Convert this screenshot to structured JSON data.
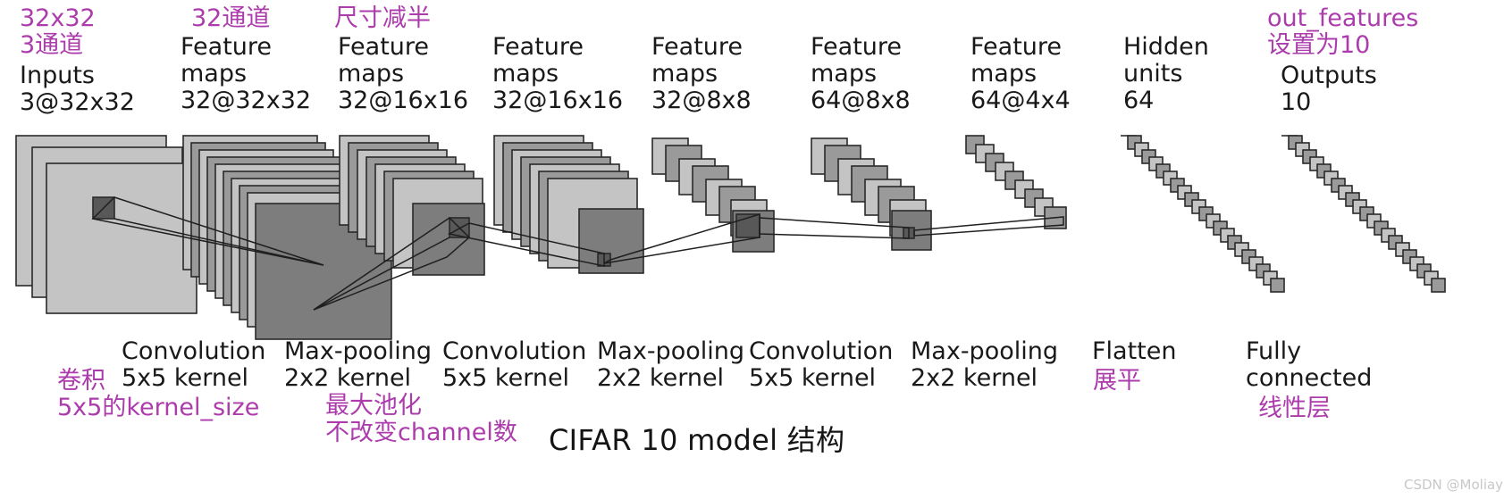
{
  "figure": {
    "title": "CIFAR 10 model 结构",
    "watermark": "CSDN @Moliay",
    "accent_color": "#ac3cac",
    "text_color": "#191919"
  },
  "top_labels": [
    {
      "id": "inputs",
      "annotation": "32x32\n3通道",
      "english": "Inputs\n3@32x32"
    },
    {
      "id": "feature-maps-1",
      "annotation": "32通道",
      "english": "Feature\nmaps\n32@32x32"
    },
    {
      "id": "feature-maps-2",
      "annotation": "尺寸减半",
      "english": "Feature\nmaps\n32@16x16"
    },
    {
      "id": "feature-maps-3",
      "annotation": "",
      "english": "Feature\nmaps\n32@16x16"
    },
    {
      "id": "feature-maps-4",
      "annotation": "",
      "english": "Feature\nmaps\n32@8x8"
    },
    {
      "id": "feature-maps-5",
      "annotation": "",
      "english": "Feature\nmaps\n64@8x8"
    },
    {
      "id": "feature-maps-6",
      "annotation": "",
      "english": "Feature\nmaps\n64@4x4"
    },
    {
      "id": "hidden-units",
      "annotation": "",
      "english": "Hidden\nunits\n64"
    },
    {
      "id": "outputs",
      "annotation": "out_features\n设置为10",
      "english": "Outputs\n10"
    }
  ],
  "bottom_labels": [
    {
      "id": "convolution-1",
      "english": "Convolution\n5x5 kernel",
      "annotation": "卷积\n5x5的kernel_size"
    },
    {
      "id": "max-pooling-1",
      "english": "Max-pooling\n2x2 kernel",
      "annotation": "最大池化\n不改变channel数"
    },
    {
      "id": "convolution-2",
      "english": "Convolution\n5x5 kernel",
      "annotation": ""
    },
    {
      "id": "max-pooling-2",
      "english": "Max-pooling\n2x2 kernel",
      "annotation": ""
    },
    {
      "id": "convolution-3",
      "english": "Convolution\n5x5 kernel",
      "annotation": ""
    },
    {
      "id": "max-pooling-3",
      "english": "Max-pooling\n2x2 kernel",
      "annotation": ""
    },
    {
      "id": "flatten",
      "english": "Flatten",
      "annotation": "展平"
    },
    {
      "id": "fully-connected",
      "english": "Fully\nconnected",
      "annotation": "线性层"
    }
  ],
  "chart_data": {
    "type": "diagram",
    "title": "CIFAR 10 model 结构",
    "description": "Convolutional neural network architecture diagram for CIFAR-10",
    "layers": [
      {
        "name": "Inputs",
        "shape": "3@32x32",
        "channels": 3,
        "size": 32,
        "kind": "input"
      },
      {
        "name": "Feature maps",
        "shape": "32@32x32",
        "channels": 32,
        "size": 32,
        "kind": "conv",
        "op": "Convolution 5x5 kernel"
      },
      {
        "name": "Feature maps",
        "shape": "32@16x16",
        "channels": 32,
        "size": 16,
        "kind": "pool",
        "op": "Max-pooling 2x2 kernel"
      },
      {
        "name": "Feature maps",
        "shape": "32@16x16",
        "channels": 32,
        "size": 16,
        "kind": "conv",
        "op": "Convolution 5x5 kernel"
      },
      {
        "name": "Feature maps",
        "shape": "32@8x8",
        "channels": 32,
        "size": 8,
        "kind": "pool",
        "op": "Max-pooling 2x2 kernel"
      },
      {
        "name": "Feature maps",
        "shape": "64@8x8",
        "channels": 64,
        "size": 8,
        "kind": "conv",
        "op": "Convolution 5x5 kernel"
      },
      {
        "name": "Feature maps",
        "shape": "64@4x4",
        "channels": 64,
        "size": 4,
        "kind": "pool",
        "op": "Max-pooling 2x2 kernel"
      },
      {
        "name": "Hidden units",
        "shape": "64",
        "units": 64,
        "kind": "dense",
        "op": "Flatten"
      },
      {
        "name": "Outputs",
        "shape": "10",
        "units": 10,
        "kind": "dense",
        "op": "Fully connected"
      }
    ]
  }
}
